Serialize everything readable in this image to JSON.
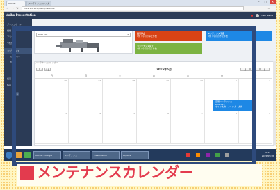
{
  "browser": {
    "tabs": [
      {
        "label": "Wordle"
      },
      {
        "label": "メンテナンスカレンダー"
      }
    ],
    "url": "172.21.0.131:/Maint/Calendar"
  },
  "app": {
    "logo": "daiko Presentation",
    "user": "User Name"
  },
  "sidebar": {
    "items": [
      {
        "label": "ダッシュボード"
      },
      {
        "label": "機械"
      },
      {
        "label": "アラーム"
      },
      {
        "label": "予知保全"
      },
      {
        "label": "メンテナンス"
      },
      {
        "label": "設定"
      },
      {
        "label": "帳票"
      }
    ],
    "subitems": [
      {
        "label": "カレンダー"
      },
      {
        "label": "履歴"
      }
    ],
    "collapse_glyph": "«"
  },
  "machine_select": {
    "value": "DMP-42S"
  },
  "tiles": [
    {
      "title": "異常停止",
      "sub": "0件 / 今月の停止件数",
      "color": "#d84315"
    },
    {
      "title": "メンテナンス予定",
      "sub": "0件 / 今月の予定件数",
      "color": "#1e88e5"
    },
    {
      "title": "メンテナンス完了",
      "sub": "0件 / 今月の完了件数",
      "color": "#7cb342"
    }
  ],
  "calendar": {
    "section_title": "メンテナンスカレンダー",
    "month_label": "2015年5月",
    "nav": {
      "prev": "‹",
      "next": "›",
      "today": "今日"
    },
    "views": [
      "月",
      "週",
      "日"
    ],
    "weekdays": [
      "日",
      "月",
      "火",
      "水",
      "木",
      "金",
      "土"
    ],
    "days": [
      "26",
      "27",
      "28",
      "29",
      "30",
      "1",
      "2",
      "3",
      "4",
      "5",
      "6",
      "7",
      "8",
      "9"
    ],
    "event": {
      "line1": "定期メンテナンス",
      "line2": "DMP-42S",
      "line3": "オイル交換・フィルター交換"
    }
  },
  "taskbar": {
    "windows": [
      {
        "label": "Wordle - Google"
      },
      {
        "label": "メンテナンス"
      },
      {
        "label": "Presentation"
      },
      {
        "label": "Explorer"
      }
    ],
    "clock": {
      "time": "10:27",
      "date": "2015/05/18"
    }
  },
  "overlay_caption": "メンテナンスカレンダー",
  "colors": {
    "frame": "#2e4a7c",
    "caption": "#e33b4e",
    "header": "#2b3b56"
  }
}
